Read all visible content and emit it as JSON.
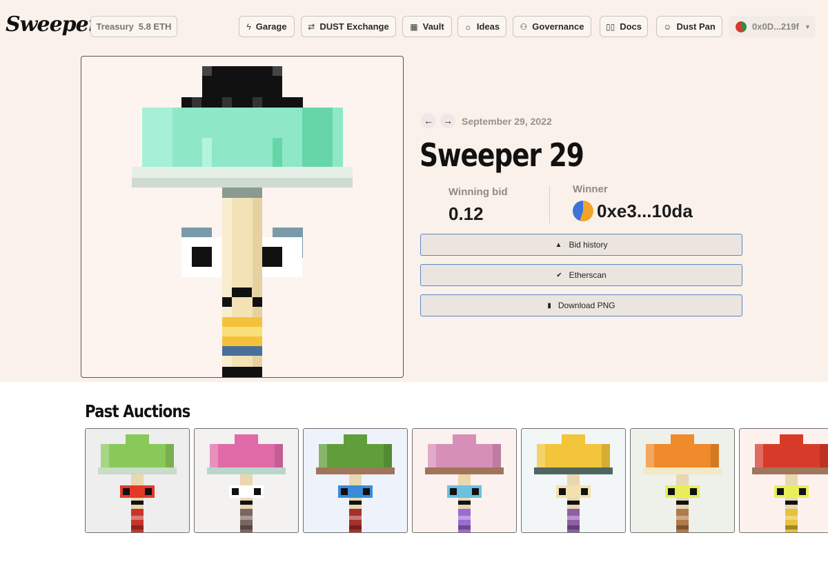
{
  "header": {
    "logo_text": "Sweepers",
    "treasury_label": "Treasury",
    "treasury_value": "5.8 ETH",
    "nav": [
      {
        "label": "Garage",
        "icon": "lightning-icon"
      },
      {
        "label": "DUST Exchange",
        "icon": "swap-icon"
      },
      {
        "label": "Vault",
        "icon": "grid-icon"
      },
      {
        "label": "Ideas",
        "icon": "sun-icon"
      },
      {
        "label": "Governance",
        "icon": "users-icon"
      },
      {
        "label": "Docs",
        "icon": "book-icon"
      },
      {
        "label": "Dust Pan",
        "icon": "smile-icon"
      }
    ],
    "wallet_address": "0x0D...219f"
  },
  "auction": {
    "date": "September 29, 2022",
    "title": "Sweeper 29",
    "winning_bid_label": "Winning bid",
    "winning_bid_value": "0.12",
    "winner_label": "Winner",
    "winner_value": "0xe3...10da",
    "buttons": [
      {
        "label": "Bid history",
        "icon": "gavel-icon"
      },
      {
        "label": "Etherscan",
        "icon": "check-circle-icon"
      },
      {
        "label": "Download PNG",
        "icon": "file-icon"
      }
    ]
  },
  "past_auctions": {
    "title": "Past Auctions",
    "thumbnails": [
      {
        "bg": "#eeeeee",
        "hat": "#89c95a",
        "brim": "#c8dcc7",
        "face": "#e23a26",
        "body": "#c9342a"
      },
      {
        "bg": "#f3f2f1",
        "hat": "#e06aa8",
        "brim": "#b9d6c8",
        "face": "#ffffff",
        "body": "#7a6560"
      },
      {
        "bg": "#eef3fb",
        "hat": "#5f9e3a",
        "brim": "#a0755a",
        "face": "#3b8bd6",
        "body": "#a7302a"
      },
      {
        "bg": "#fbf1ef",
        "hat": "#d68fb7",
        "brim": "#a0755a",
        "face": "#6cc0e0",
        "body": "#9a6bd0"
      },
      {
        "bg": "#f2f6f6",
        "hat": "#f2c53a",
        "brim": "#4f6660",
        "face": "#f3e1b0",
        "body": "#8e5ea6"
      },
      {
        "bg": "#eef0ea",
        "hat": "#f08a2a",
        "brim": "#f5e9c5",
        "face": "#e8ee5a",
        "body": "#b07a4a"
      },
      {
        "bg": "#fdf1ee",
        "hat": "#d83a2a",
        "brim": "#a0755a",
        "face": "#e8ee5a",
        "body": "#e8c23a"
      }
    ]
  },
  "colors": {
    "top_bg": "#faf1ea",
    "button_border": "#5a86c9",
    "button_bg": "#ece5df"
  }
}
